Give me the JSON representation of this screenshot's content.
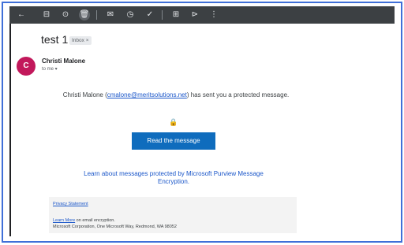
{
  "toolbar": {
    "icons": [
      {
        "name": "back-arrow-icon",
        "glyph": "←"
      },
      {
        "name": "archive-icon",
        "glyph": "⊟"
      },
      {
        "name": "report-spam-icon",
        "glyph": "⊙"
      },
      {
        "name": "delete-icon",
        "glyph": "🗑"
      },
      {
        "name": "mark-unread-icon",
        "glyph": "✉"
      },
      {
        "name": "snooze-icon",
        "glyph": "◷"
      },
      {
        "name": "add-task-icon",
        "glyph": "✓"
      },
      {
        "name": "move-to-icon",
        "glyph": "⊞"
      },
      {
        "name": "label-icon",
        "glyph": "⊳"
      },
      {
        "name": "more-options-icon",
        "glyph": "⋮"
      }
    ]
  },
  "email": {
    "subject": "test 1",
    "label": "Inbox ×",
    "avatar_initial": "C",
    "sender": "Christi Malone",
    "to_me": "to me ▾",
    "sent_prefix": "Christi Malone (",
    "sent_email": "cmalone@meritsolutions.net",
    "sent_suffix": ") has sent you a protected message.",
    "lock_icon": "🔒",
    "read_button": "Read the message",
    "learn_link": "Learn about messages protected by Microsoft Purview Message Encryption."
  },
  "footer": {
    "privacy": "Privacy Statement",
    "learn_more": "Learn More",
    "encryption_text": " on email encryption.",
    "address": "Microsoft Corporation, One Microsoft Way, Redmond, WA 98052"
  },
  "colors": {
    "toolbar_bg": "#3c4043",
    "frame_border": "#3f6fd8",
    "avatar_bg": "#c2185b",
    "button_bg": "#0f6cbd",
    "link": "#1a56c9"
  }
}
